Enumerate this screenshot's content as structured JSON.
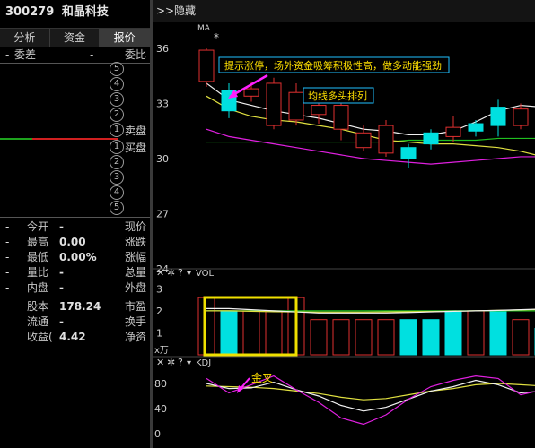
{
  "stock": {
    "code": "300279",
    "name": "和晶科技"
  },
  "tabs": [
    {
      "label": "报价",
      "active": true
    },
    {
      "label": "资金",
      "active": false
    },
    {
      "label": "分析",
      "active": false
    }
  ],
  "order_book": {
    "weibi_label": "委比",
    "weibi_value": "-",
    "weicha_label": "委差",
    "weicha_value": "-",
    "sell_label": "卖盘",
    "buy_label": "买盘",
    "circles": [
      "5",
      "4",
      "3",
      "2",
      "1",
      "1",
      "2",
      "3",
      "4",
      "5"
    ]
  },
  "stats": [
    {
      "label": "现价",
      "value": "-",
      "label2": "今开",
      "value2": "-"
    },
    {
      "label": "涨跌",
      "value": "0.00",
      "label2": "最高",
      "value2": "-"
    },
    {
      "label": "涨幅",
      "value": "0.00%",
      "label2": "最低",
      "value2": "-"
    },
    {
      "label": "总量",
      "value": "-",
      "label2": "量比",
      "value2": "-"
    },
    {
      "label": "外盘",
      "value": "-",
      "label2": "内盘",
      "value2": "-"
    }
  ],
  "stats2": [
    {
      "label": "市盈",
      "value": "178.24",
      "label2": "股本",
      "value2": ""
    },
    {
      "label": "换手",
      "value": "-",
      "label2": "流通",
      "value2": ""
    },
    {
      "label": "净资",
      "value": "4.42",
      "label2": "收益(",
      "value2": ""
    }
  ],
  "chart_header": {
    "hide_label": "隐藏",
    "ma_label": "MA"
  },
  "annotations": {
    "note1": "提示涨停，场外资金吸筹积极性高，做多动能强劲",
    "note2": "均线多头排列",
    "golden_cross": "金叉"
  },
  "colors": {
    "up": "#e03030",
    "down": "#00e0e0",
    "ma_white": "#f0f0f0",
    "ma_yellow": "#e0e040",
    "ma_magenta": "#e020e0",
    "ma_green": "#20c020",
    "annotation_arrow": "#ff20ff",
    "highlight_box": "#f0e000"
  },
  "chart_data": [
    {
      "type": "candlestick",
      "title": "",
      "y_ticks": [
        36,
        33,
        30,
        27,
        24
      ],
      "ylim": [
        24,
        36
      ],
      "candles": [
        {
          "o": 34.2,
          "c": 35.9,
          "h": 36.0,
          "l": 33.9,
          "dir": "up"
        },
        {
          "o": 33.7,
          "c": 32.6,
          "h": 34.1,
          "l": 32.2,
          "dir": "down"
        },
        {
          "o": 33.4,
          "c": 33.8,
          "h": 34.2,
          "l": 33.1,
          "dir": "up"
        },
        {
          "o": 31.8,
          "c": 34.1,
          "h": 34.4,
          "l": 31.6,
          "dir": "up"
        },
        {
          "o": 32.1,
          "c": 33.6,
          "h": 34.1,
          "l": 31.8,
          "dir": "up"
        },
        {
          "o": 32.4,
          "c": 32.9,
          "h": 33.2,
          "l": 31.9,
          "dir": "up"
        },
        {
          "o": 31.6,
          "c": 32.9,
          "h": 33.3,
          "l": 31.0,
          "dir": "up"
        },
        {
          "o": 30.6,
          "c": 31.4,
          "h": 31.8,
          "l": 30.4,
          "dir": "up"
        },
        {
          "o": 30.3,
          "c": 31.8,
          "h": 32.1,
          "l": 30.1,
          "dir": "up"
        },
        {
          "o": 30.6,
          "c": 30.0,
          "h": 30.8,
          "l": 29.5,
          "dir": "down"
        },
        {
          "o": 31.4,
          "c": 30.8,
          "h": 31.6,
          "l": 30.5,
          "dir": "down"
        },
        {
          "o": 31.2,
          "c": 31.7,
          "h": 32.3,
          "l": 30.9,
          "dir": "up"
        },
        {
          "o": 31.9,
          "c": 31.5,
          "h": 32.1,
          "l": 31.2,
          "dir": "down"
        },
        {
          "o": 32.8,
          "c": 31.8,
          "h": 33.2,
          "l": 31.2,
          "dir": "down"
        },
        {
          "o": 31.8,
          "c": 32.7,
          "h": 33.0,
          "l": 31.6,
          "dir": "up"
        },
        {
          "o": 32.8,
          "c": 32.5,
          "h": 32.9,
          "l": 32.4,
          "dir": "down"
        },
        {
          "o": 32.7,
          "c": 32.9,
          "h": 33.6,
          "l": 31.6,
          "dir": "up"
        },
        {
          "o": 31.8,
          "c": 32.3,
          "h": 32.6,
          "l": 31.0,
          "dir": "up"
        }
      ],
      "ma_lines": {
        "white": [
          34.1,
          33.2,
          32.9,
          32.6,
          32.4,
          32.2,
          31.9,
          31.6,
          31.5,
          31.3,
          31.3,
          31.5,
          32.0,
          32.6,
          32.9,
          32.8,
          32.2,
          31.0
        ],
        "yellow": [
          33.4,
          32.7,
          32.3,
          32.1,
          32.0,
          31.8,
          31.6,
          31.3,
          31.0,
          30.9,
          30.8,
          30.8,
          30.7,
          30.6,
          30.4,
          30.1,
          29.8,
          29.6
        ],
        "magenta": [
          31.6,
          31.2,
          31.0,
          30.8,
          30.6,
          30.4,
          30.2,
          30.0,
          29.9,
          29.8,
          29.7,
          29.8,
          29.9,
          30.0,
          30.1,
          30.1,
          30.0,
          29.4
        ],
        "green": [
          30.9,
          30.9,
          30.9,
          30.9,
          30.9,
          30.9,
          30.9,
          30.9,
          30.9,
          31.0,
          31.0,
          31.0,
          31.0,
          31.1,
          31.1,
          31.1,
          31.1,
          31.1
        ]
      }
    },
    {
      "type": "bar",
      "title": "VOL",
      "y_ticks": [
        3,
        2,
        1
      ],
      "unit_label": "x万",
      "ylim": [
        0,
        3.5
      ],
      "values": [
        2.6,
        2.0,
        2.0,
        2.0,
        2.6,
        1.6,
        1.6,
        1.6,
        1.6,
        1.6,
        1.6,
        2.0,
        2.0,
        2.0,
        1.6,
        1.2,
        1.6,
        1.6
      ],
      "dirs": [
        "up",
        "down",
        "up",
        "up",
        "up",
        "up",
        "up",
        "up",
        "up",
        "down",
        "down",
        "down",
        "up",
        "down",
        "up",
        "down",
        "up",
        "up"
      ],
      "ma_white": [
        2.1,
        2.1,
        2.05,
        2.0,
        1.95,
        1.9,
        1.9,
        1.9,
        1.9,
        1.92,
        1.95,
        1.98,
        2.0,
        2.02,
        2.05,
        2.08,
        2.1,
        2.1
      ],
      "ma_yellow": [
        2.0,
        2.0,
        1.98,
        1.96,
        1.95,
        1.94,
        1.94,
        1.94,
        1.95,
        1.96,
        1.97,
        1.98,
        2.0,
        2.02,
        2.04,
        2.06,
        2.08,
        2.1
      ],
      "ma_green": [
        2.0,
        2.0,
        2.0,
        2.0,
        2.0,
        2.0,
        2.0,
        2.0,
        2.0,
        2.0,
        2.0,
        2.0,
        2.0,
        2.0,
        2.0,
        2.0,
        2.0,
        2.05
      ]
    },
    {
      "type": "line",
      "title": "KDJ",
      "y_ticks": [
        80,
        40,
        0
      ],
      "ylim": [
        0,
        100
      ],
      "K": [
        80,
        72,
        73,
        82,
        70,
        60,
        45,
        36,
        42,
        55,
        68,
        75,
        85,
        78,
        65,
        68,
        75,
        80
      ],
      "D": [
        76,
        75,
        74,
        72,
        68,
        64,
        58,
        54,
        56,
        62,
        68,
        72,
        78,
        80,
        78,
        76,
        76,
        78
      ],
      "J": [
        88,
        65,
        78,
        92,
        70,
        50,
        25,
        15,
        30,
        55,
        75,
        85,
        92,
        88,
        62,
        70,
        80,
        85
      ]
    }
  ]
}
